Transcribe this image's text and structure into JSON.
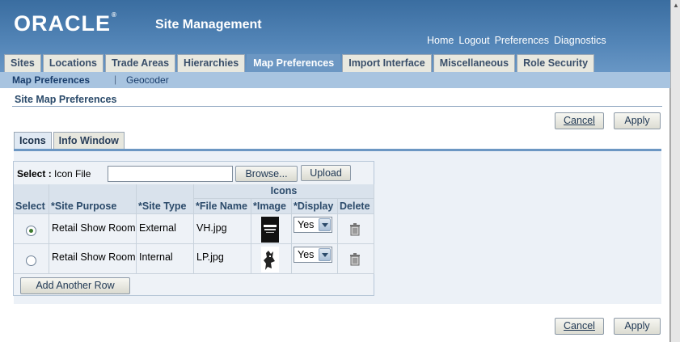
{
  "header": {
    "logo": "ORACLE",
    "app_title": "Site Management",
    "global_links": [
      "Home",
      "Logout",
      "Preferences",
      "Diagnostics"
    ]
  },
  "tabs": [
    {
      "label": "Sites"
    },
    {
      "label": "Locations"
    },
    {
      "label": "Trade Areas"
    },
    {
      "label": "Hierarchies"
    },
    {
      "label": "Map Preferences",
      "selected": true
    },
    {
      "label": "Import Interface"
    },
    {
      "label": "Miscellaneous"
    },
    {
      "label": "Role Security"
    }
  ],
  "subnav": {
    "items": [
      "Map Preferences",
      "Geocoder"
    ],
    "separator": "|"
  },
  "page": {
    "title": "Site Map Preferences",
    "cancel_label": "Cancel",
    "apply_label": "Apply"
  },
  "content_tabs": [
    {
      "label": "Icons",
      "selected": true
    },
    {
      "label": "Info Window"
    }
  ],
  "upload": {
    "select_label": "Select :",
    "field_label": "Icon File",
    "file_value": "",
    "browse_label": "Browse...",
    "upload_label": "Upload"
  },
  "table": {
    "group_header": "Icons",
    "columns": [
      "Select",
      "*Site Purpose",
      "*Site Type",
      "*File Name",
      "*Image",
      "*Display",
      "Delete"
    ],
    "rows": [
      {
        "selected": true,
        "site_purpose": "Retail Show Room",
        "site_type": "External",
        "file_name": "VH.jpg",
        "display": "Yes"
      },
      {
        "selected": false,
        "site_purpose": "Retail Show Room",
        "site_type": "Internal",
        "file_name": "LP.jpg",
        "display": "Yes"
      }
    ],
    "add_row_label": "Add Another Row"
  },
  "colors": {
    "header_blue": "#4a7cb0",
    "tab_selected": "#6c97c3",
    "subnav_blue": "#a8c4e0"
  }
}
